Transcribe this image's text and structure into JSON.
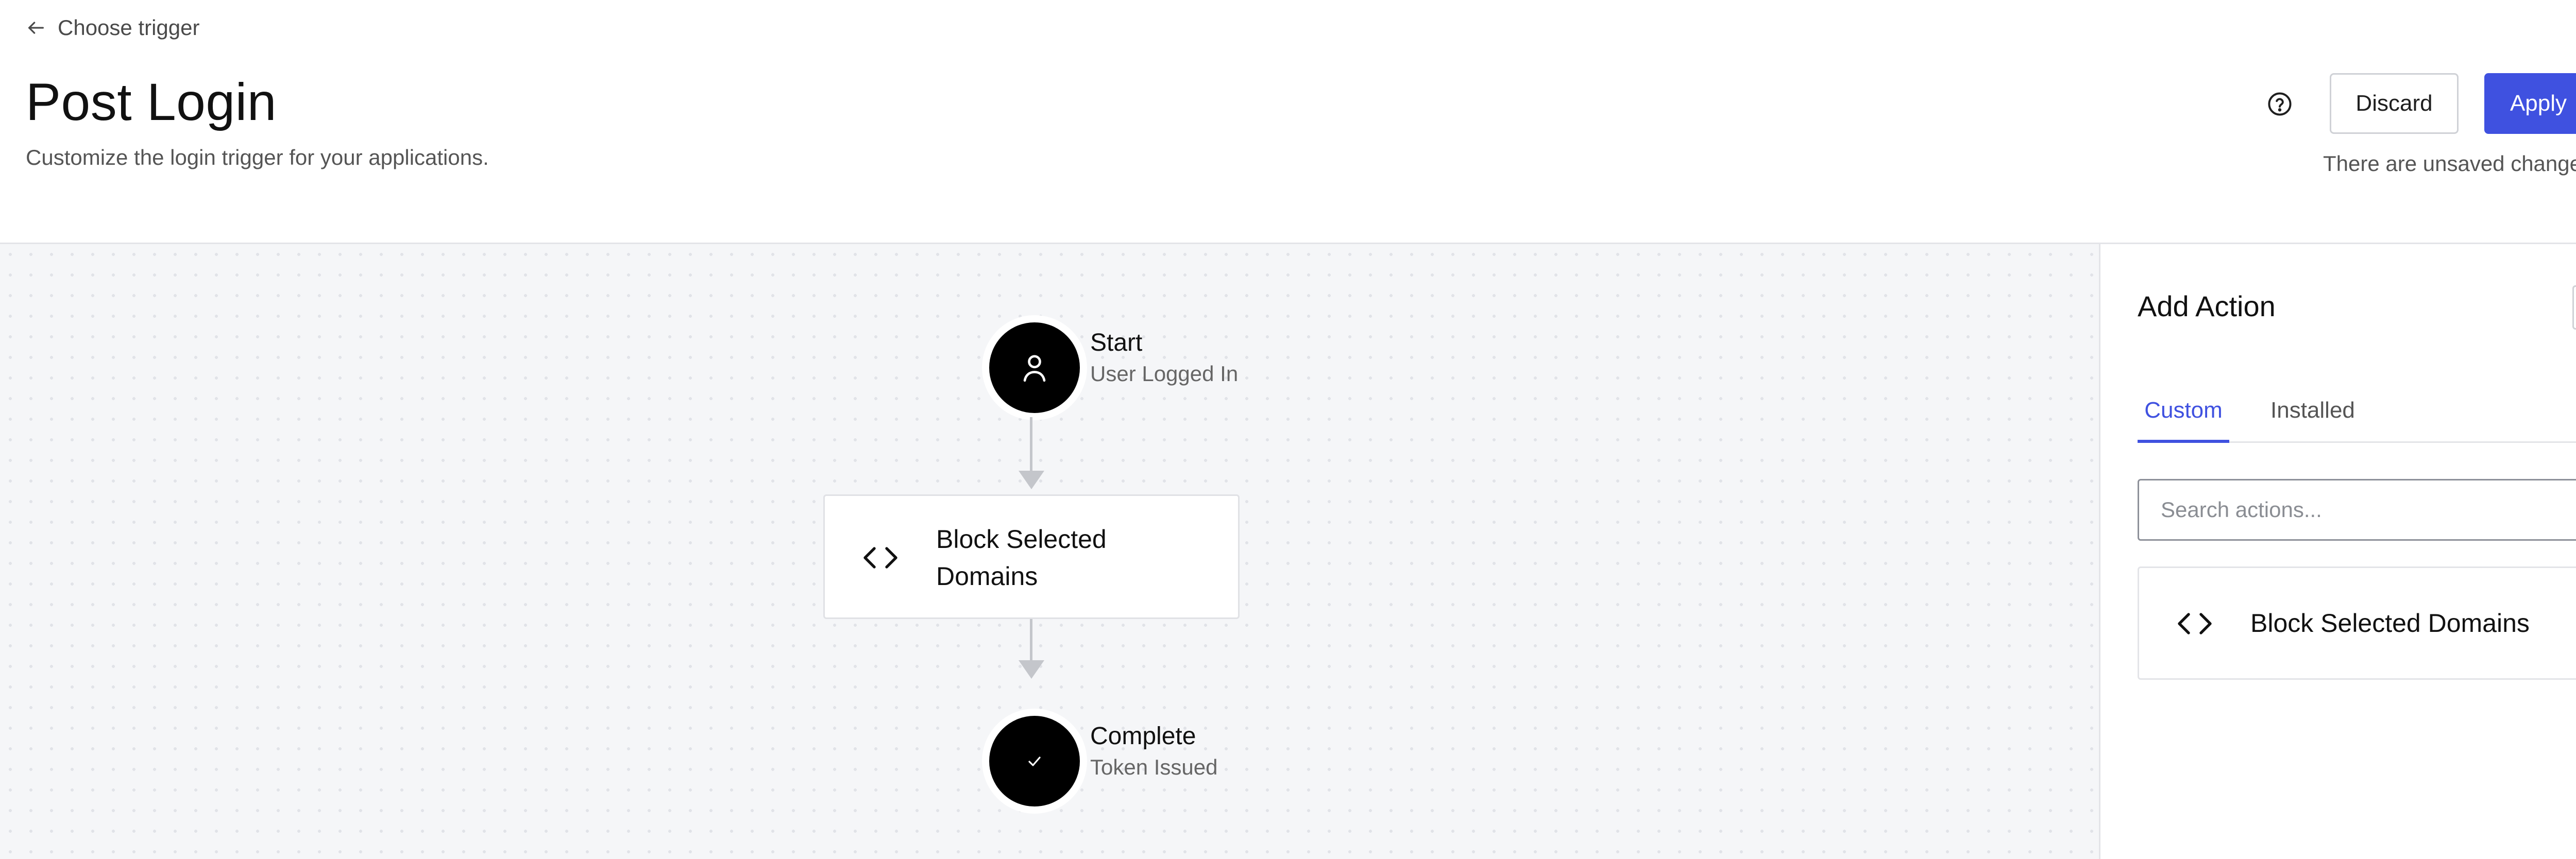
{
  "header": {
    "back_label": "Choose trigger",
    "title": "Post Login",
    "subtitle": "Customize the login trigger for your applications.",
    "discard_label": "Discard",
    "apply_label": "Apply",
    "unsaved_text": "There are unsaved changes"
  },
  "flow": {
    "start": {
      "title": "Start",
      "subtitle": "User Logged In",
      "icon": "user-icon"
    },
    "action": {
      "label": "Block Selected Domains",
      "icon": "code-icon"
    },
    "complete": {
      "title": "Complete",
      "subtitle": "Token Issued",
      "icon": "check-icon"
    }
  },
  "panel": {
    "title": "Add Action",
    "tabs": [
      {
        "label": "Custom",
        "active": true
      },
      {
        "label": "Installed",
        "active": false
      }
    ],
    "search_placeholder": "Search actions...",
    "results": [
      {
        "label": "Block Selected Domains",
        "icon": "code-icon"
      }
    ]
  },
  "colors": {
    "accent": "#3f51e0",
    "canvas_bg": "#f5f6f8",
    "node_bg": "#000000",
    "connector": "#c4c6cb"
  }
}
